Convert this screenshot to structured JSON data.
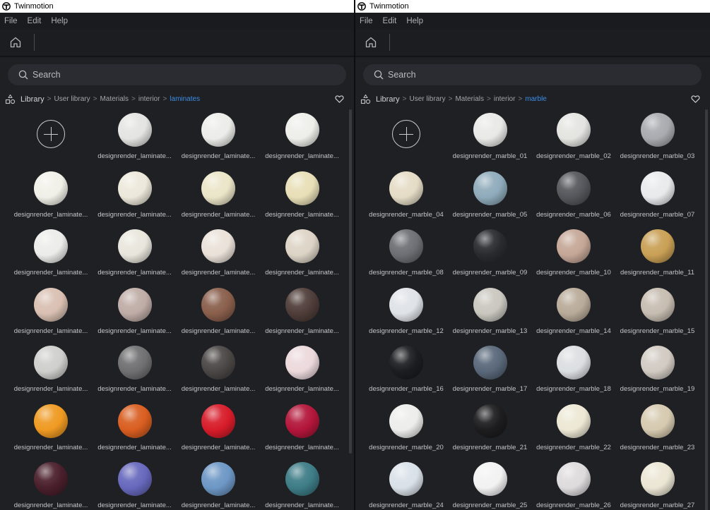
{
  "app_title": "Twinmotion",
  "menu": [
    "File",
    "Edit",
    "Help"
  ],
  "search_placeholder": "Search",
  "add_symbol": "+",
  "panes": [
    {
      "breadcrumb": [
        "Library",
        "User library",
        "Materials",
        "interior",
        "laminates"
      ],
      "items": [
        {
          "label": "",
          "color": "",
          "add": true
        },
        {
          "label": "designrender_laminate...",
          "color": "#e4e4e2"
        },
        {
          "label": "designrender_laminate...",
          "color": "#ecece9"
        },
        {
          "label": "designrender_laminate...",
          "color": "#eeeeea"
        },
        {
          "label": "designrender_laminate...",
          "color": "#f1f0e8"
        },
        {
          "label": "designrender_laminate...",
          "color": "#ece8da"
        },
        {
          "label": "designrender_laminate...",
          "color": "#ebe5c8"
        },
        {
          "label": "designrender_laminate...",
          "color": "#e8dfb7"
        },
        {
          "label": "designrender_laminate...",
          "color": "#ececea"
        },
        {
          "label": "designrender_laminate...",
          "color": "#e8e6dc"
        },
        {
          "label": "designrender_laminate...",
          "color": "#eae2d9"
        },
        {
          "label": "designrender_laminate...",
          "color": "#ddd4c6"
        },
        {
          "label": "designrender_laminate...",
          "color": "#d9c0b2"
        },
        {
          "label": "designrender_laminate...",
          "color": "#bfaca6"
        },
        {
          "label": "designrender_laminate...",
          "color": "#8a5f4c"
        },
        {
          "label": "designrender_laminate...",
          "color": "#4f3d39"
        },
        {
          "label": "designrender_laminate...",
          "color": "#cfcfcd"
        },
        {
          "label": "designrender_laminate...",
          "color": "#707072"
        },
        {
          "label": "designrender_laminate...",
          "color": "#4a4745"
        },
        {
          "label": "designrender_laminate...",
          "color": "#ecd9dc"
        },
        {
          "label": "designrender_laminate...",
          "color": "#ef9a22"
        },
        {
          "label": "designrender_laminate...",
          "color": "#d95e20"
        },
        {
          "label": "designrender_laminate...",
          "color": "#d81c2a"
        },
        {
          "label": "designrender_laminate...",
          "color": "#b3163a"
        },
        {
          "label": "designrender_laminate...",
          "color": "#4a1f2c"
        },
        {
          "label": "designrender_laminate...",
          "color": "#6768bd"
        },
        {
          "label": "designrender_laminate...",
          "color": "#6d97c5"
        },
        {
          "label": "designrender_laminate...",
          "color": "#3d7c86"
        }
      ]
    },
    {
      "breadcrumb": [
        "Library",
        "User library",
        "Materials",
        "interior",
        "marble"
      ],
      "items": [
        {
          "label": "",
          "color": "",
          "add": true
        },
        {
          "label": "designrender_marble_01",
          "color": "#e9e9e8"
        },
        {
          "label": "designrender_marble_02",
          "color": "#e4e4e1"
        },
        {
          "label": "designrender_marble_03",
          "color": "#a9abb0"
        },
        {
          "label": "designrender_marble_04",
          "color": "#e5dcc6"
        },
        {
          "label": "designrender_marble_05",
          "color": "#8fabbb"
        },
        {
          "label": "designrender_marble_06",
          "color": "#55575c"
        },
        {
          "label": "designrender_marble_07",
          "color": "#e8eaec"
        },
        {
          "label": "designrender_marble_08",
          "color": "#6d6f74"
        },
        {
          "label": "designrender_marble_09",
          "color": "#2a2b2f"
        },
        {
          "label": "designrender_marble_10",
          "color": "#c5a797"
        },
        {
          "label": "designrender_marble_11",
          "color": "#c9a055"
        },
        {
          "label": "designrender_marble_12",
          "color": "#dfe3e8"
        },
        {
          "label": "designrender_marble_13",
          "color": "#c9c7bf"
        },
        {
          "label": "designrender_marble_14",
          "color": "#b9ab99"
        },
        {
          "label": "designrender_marble_15",
          "color": "#c7bdb1"
        },
        {
          "label": "designrender_marble_16",
          "color": "#1c1d20"
        },
        {
          "label": "designrender_marble_17",
          "color": "#59687a"
        },
        {
          "label": "designrender_marble_18",
          "color": "#dcdfe1"
        },
        {
          "label": "designrender_marble_19",
          "color": "#d2cbc3"
        },
        {
          "label": "designrender_marble_20",
          "color": "#ededec"
        },
        {
          "label": "designrender_marble_21",
          "color": "#1d1d1f"
        },
        {
          "label": "designrender_marble_22",
          "color": "#ede8d5"
        },
        {
          "label": "designrender_marble_23",
          "color": "#d6cab0"
        },
        {
          "label": "designrender_marble_24",
          "color": "#d9e1e8"
        },
        {
          "label": "designrender_marble_25",
          "color": "#f2f2f2"
        },
        {
          "label": "designrender_marble_26",
          "color": "#dedbdd"
        },
        {
          "label": "designrender_marble_27",
          "color": "#ebe6d4"
        }
      ]
    }
  ]
}
